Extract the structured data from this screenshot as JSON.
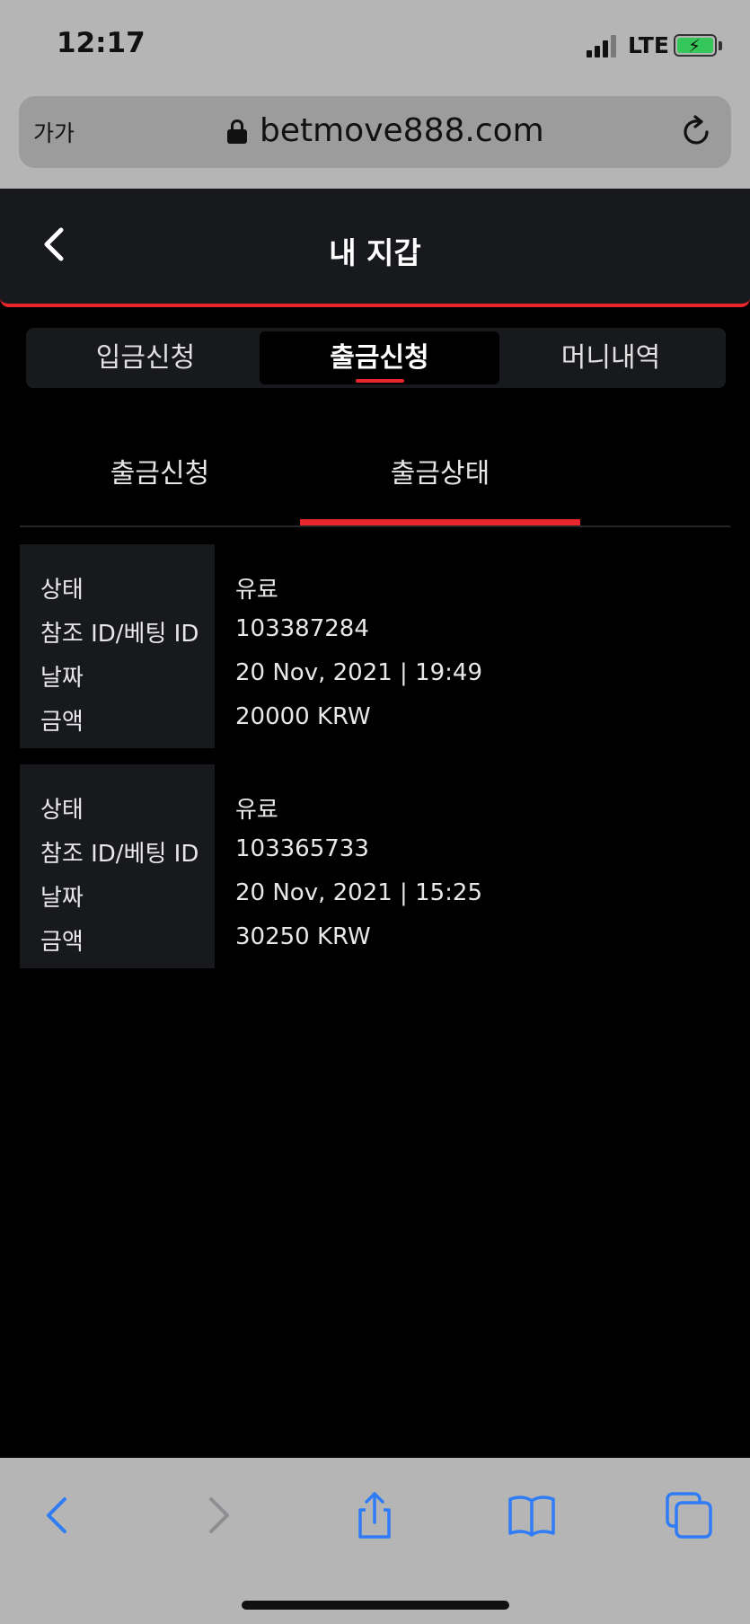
{
  "status_bar": {
    "time": "12:17",
    "network": "LTE",
    "battery_color": "#35c759"
  },
  "browser": {
    "text_size_label": "가가",
    "url": "betmove888.com",
    "icons": [
      "lock-icon",
      "reload-icon"
    ]
  },
  "header": {
    "title": "내 지갑",
    "accent_color": "#e8262b"
  },
  "top_tabs": [
    {
      "label": "입금신청",
      "active": false
    },
    {
      "label": "출금신청",
      "active": true
    },
    {
      "label": "머니내역",
      "active": false
    }
  ],
  "sub_tabs": [
    {
      "label": "출금신청",
      "active": false
    },
    {
      "label": "출금상태",
      "active": true
    }
  ],
  "records": [
    {
      "status_label": "상태",
      "status_value": "유료",
      "ref_label": "참조 ID/베팅 ID",
      "ref_value": "103387284",
      "date_label": "날짜",
      "date_value": "20 Nov, 2021 | 19:49",
      "amount_label": "금액",
      "amount_value": "20000 KRW"
    },
    {
      "status_label": "상태",
      "status_value": "유료",
      "ref_label": "참조 ID/베팅 ID",
      "ref_value": "103365733",
      "date_label": "날짜",
      "date_value": "20 Nov, 2021 | 15:25",
      "amount_label": "금액",
      "amount_value": "30250 KRW"
    }
  ],
  "toolbar": {
    "icons": [
      "back-arrow-icon",
      "forward-arrow-icon",
      "share-icon",
      "bookmarks-icon",
      "tabs-icon"
    ],
    "icon_color": "#2f7cf6"
  }
}
